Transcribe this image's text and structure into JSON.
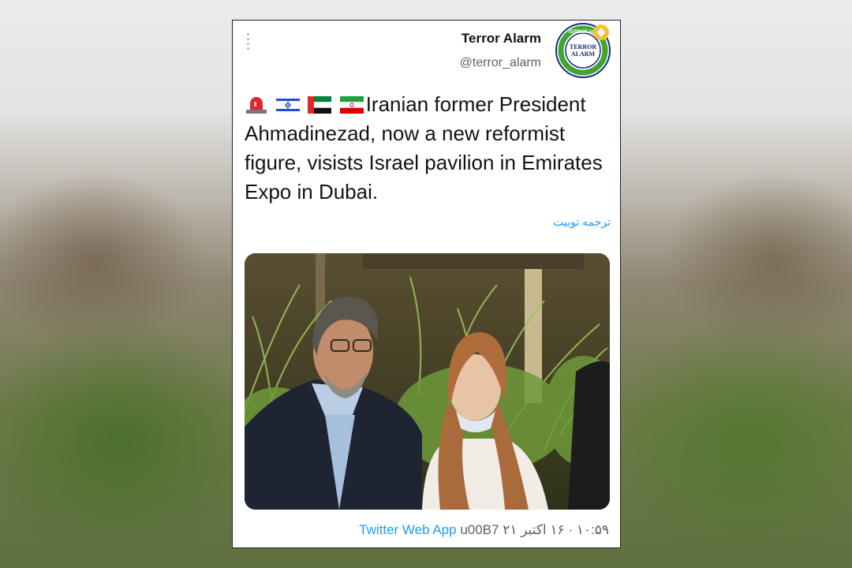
{
  "tweet": {
    "author_name": "Terror Alarm",
    "author_handle": "@terror_alarm",
    "avatar_text_top": "TERROR AL",
    "avatar_text_mid1": "TERROR",
    "avatar_text_mid2": "ALARM",
    "text": "Iranian former President Ahmadinezad, now a new reformist figure, visists Israel pavilion in Emirates Expo in Dubai.",
    "emojis": [
      "police-light",
      "israel-flag",
      "uae-flag",
      "iran-flag"
    ],
    "translate_label": "ترجمه توییت",
    "timestamp": "۱۰:۵۹ · ۱۶ اکتبر ۲۱",
    "separator": " u00B7 ",
    "source_app": "Twitter Web App"
  },
  "colors": {
    "link": "#1d9bf0",
    "text": "#0f1419",
    "muted": "#536471",
    "avatar_ring": "#1a2a7a",
    "avatar_accent": "#3fa632"
  }
}
